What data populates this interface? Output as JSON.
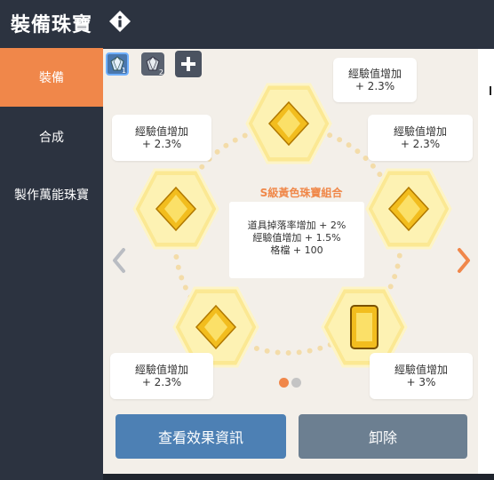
{
  "header": {
    "title": "裝備珠寶",
    "info_icon": "info-icon"
  },
  "sidebar": {
    "items": [
      {
        "label": "裝備",
        "active": true
      },
      {
        "label": "合成",
        "active": false
      },
      {
        "label": "製作萬能珠寶",
        "active": false
      }
    ]
  },
  "tabs": [
    {
      "icon": "gem-icon",
      "number": "1",
      "selected": true
    },
    {
      "icon": "gem-icon",
      "number": "2",
      "selected": false
    },
    {
      "icon": "plus-icon",
      "number": "",
      "selected": false
    }
  ],
  "slots": [
    {
      "name": "top",
      "gem": "yellow-diamond",
      "bonus_line1": "經驗值增加",
      "bonus_line2": "+ 2.3%"
    },
    {
      "name": "upper-left",
      "gem": "yellow-diamond",
      "bonus_line1": "經驗值增加",
      "bonus_line2": "+ 2.3%"
    },
    {
      "name": "upper-right",
      "gem": "yellow-diamond",
      "bonus_line1": "經驗值增加",
      "bonus_line2": "+ 2.3%"
    },
    {
      "name": "lower-left",
      "gem": "yellow-diamond",
      "bonus_line1": "經驗值增加",
      "bonus_line2": "+ 2.3%"
    },
    {
      "name": "lower-right",
      "gem": "yellow-emerald-cut",
      "bonus_line1": "經驗值增加",
      "bonus_line2": "+ 3%"
    }
  ],
  "set_bonus": {
    "title": "S級黃色珠寶組合",
    "lines": [
      "道具掉落率增加 + 2%",
      "經驗值增加 + 1.5%",
      "格檔 + 100"
    ]
  },
  "pagination": {
    "current": 1,
    "total": 2
  },
  "buttons": {
    "view_effects": "查看效果資訊",
    "unequip": "卸除"
  },
  "colors": {
    "accent": "#f0874a",
    "panel": "#f3efe9",
    "button_blue": "#4d80b4",
    "button_gray": "#6c7f91",
    "hex_yellow": "#fdf0a8"
  }
}
